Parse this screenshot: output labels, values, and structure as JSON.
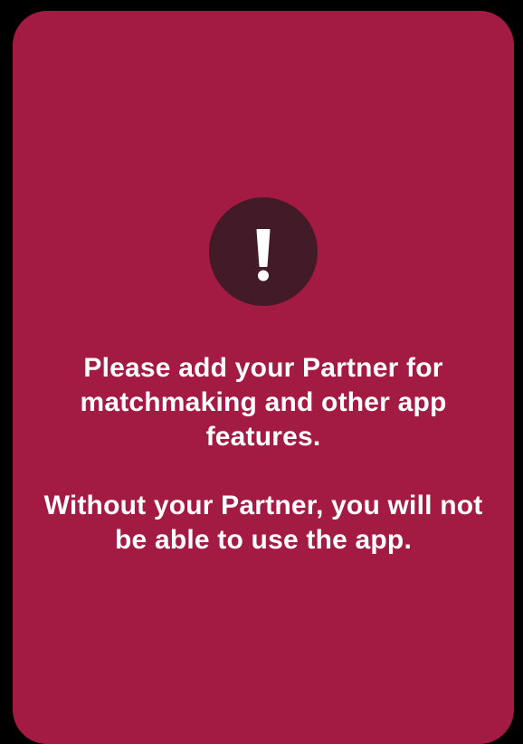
{
  "dialog": {
    "icon": "exclamation-icon",
    "message_primary": "Please add your Partner for matchmaking and other app features.",
    "message_secondary": "Without your Partner, you will not be able to use the app."
  },
  "colors": {
    "background": "#000000",
    "card": "#A31A43",
    "icon_circle": "#431B28",
    "text": "#FFFFFF"
  }
}
